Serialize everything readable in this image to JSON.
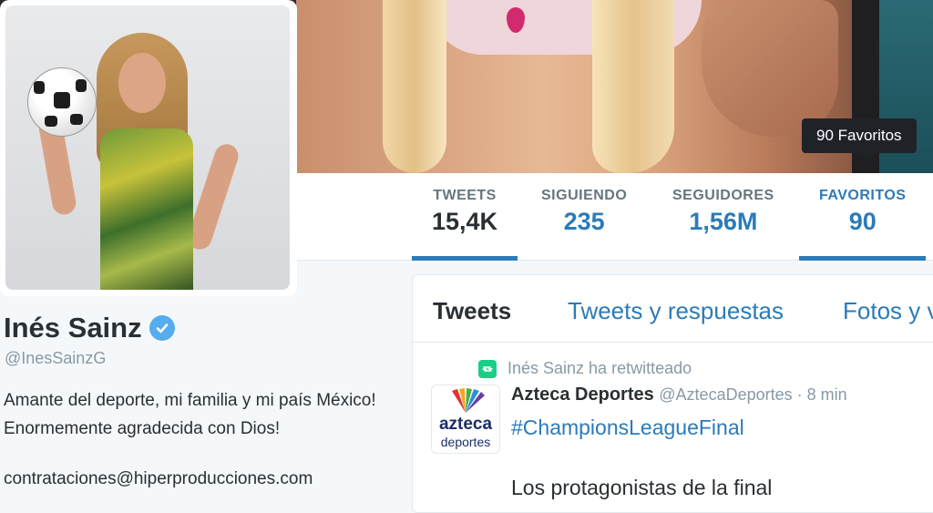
{
  "tooltip": {
    "text": "90 Favoritos"
  },
  "stats": [
    {
      "label": "TWEETS",
      "value": "15,4K"
    },
    {
      "label": "SIGUIENDO",
      "value": "235"
    },
    {
      "label": "SEGUIDORES",
      "value": "1,56M"
    },
    {
      "label": "FAVORITOS",
      "value": "90"
    }
  ],
  "profile": {
    "name": "Inés Sainz",
    "handle": "@InesSainzG",
    "bio": "Amante del deporte, mi familia y mi país México! Enormemente agradecida con Dios!",
    "email": "contrataciones@hiperproducciones.com"
  },
  "timeline": {
    "tabs": [
      "Tweets",
      "Tweets y respuestas",
      "Fotos y v"
    ]
  },
  "tweet": {
    "retweet_text": "Inés Sainz ha retwitteado",
    "author_name": "Azteca Deportes",
    "author_meta": "@AztecaDeportes · 8 min",
    "avatar_line1": "azteca",
    "avatar_line2": "deportes",
    "hashtag": "#ChampionsLeagueFinal",
    "text": "Los protagonistas de la final"
  },
  "colors": {
    "accent": "#2b7bb9",
    "verified": "#55acee",
    "retweet": "#19cf86"
  }
}
